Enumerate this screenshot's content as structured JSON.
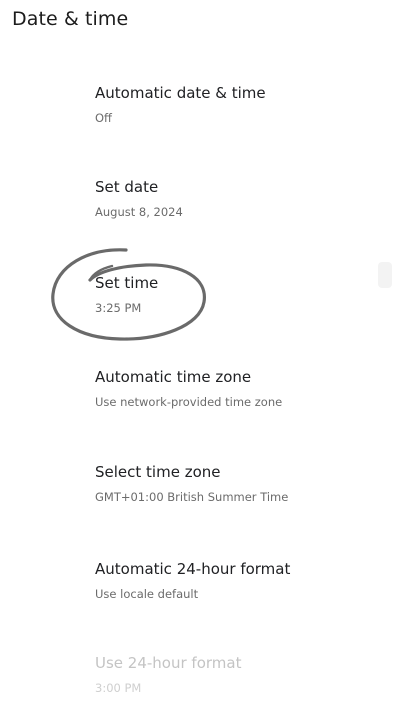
{
  "header": {
    "title": "Date & time"
  },
  "settings": [
    {
      "title": "Automatic date & time",
      "summary": "Off"
    },
    {
      "title": "Set date",
      "summary": "August 8, 2024"
    },
    {
      "title": "Set time",
      "summary": "3:25 PM"
    },
    {
      "title": "Automatic time zone",
      "summary": "Use network-provided time zone"
    },
    {
      "title": "Select time zone",
      "summary": "GMT+01:00 British Summer Time"
    },
    {
      "title": "Automatic 24-hour format",
      "summary": "Use locale default"
    },
    {
      "title": "Use 24-hour format",
      "summary": "3:00 PM",
      "enabled": false
    }
  ],
  "colors": {
    "annotation_circle": "#6a6a6a",
    "text_primary": "#202124",
    "text_secondary": "#6b6b6b",
    "text_disabled": "#c4c4c4"
  }
}
